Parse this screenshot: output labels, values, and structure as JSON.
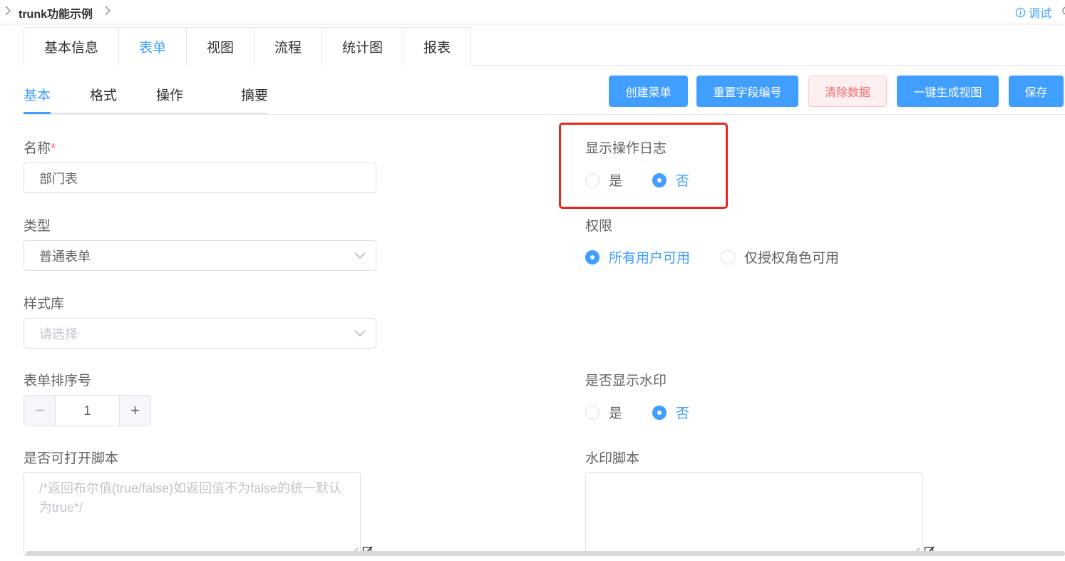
{
  "topbar": {
    "title": "trunk功能示例",
    "debug_label": "调试"
  },
  "main_tabs": [
    "基本信息",
    "表单",
    "视图",
    "流程",
    "统计图",
    "报表"
  ],
  "active_main_tab": "表单",
  "sub_tabs": [
    "基本",
    "格式",
    "操作",
    "摘要"
  ],
  "active_sub_tab": "基本",
  "toolbar": {
    "create_menu": "创建菜单",
    "reset_field_numbers": "重置字段编号",
    "clear_data": "清除数据",
    "generate_view": "一键生成视图",
    "save": "保存"
  },
  "form": {
    "name": {
      "label": "名称",
      "required_mark": "*",
      "value": "部门表"
    },
    "type": {
      "label": "类型",
      "value": "普通表单"
    },
    "style_lib": {
      "label": "样式库",
      "placeholder": "请选择"
    },
    "sort_no": {
      "label": "表单排序号",
      "value": "1",
      "minus": "−",
      "plus": "+"
    },
    "open_script": {
      "label": "是否可打开脚本",
      "placeholder": "/*返回布尔值(true/false)如返回值不为false的统一默认为true*/"
    },
    "show_log": {
      "label": "显示操作日志",
      "options": [
        "是",
        "否"
      ],
      "selected": "否"
    },
    "permission": {
      "label": "权限",
      "options": [
        "所有用户可用",
        "仅授权角色可用"
      ],
      "selected": "所有用户可用"
    },
    "show_watermark": {
      "label": "是否显示水印",
      "options": [
        "是",
        "否"
      ],
      "selected": "否"
    },
    "watermark_script": {
      "label": "水印脚本",
      "value": ""
    }
  },
  "colors": {
    "primary": "#409eff",
    "danger": "#f56c6c",
    "highlight_border": "#e8261c"
  },
  "icons": [
    "chevron-right-icon",
    "info-circle-icon",
    "chevron-down-icon",
    "edit-icon",
    "resize-handle-icon"
  ]
}
